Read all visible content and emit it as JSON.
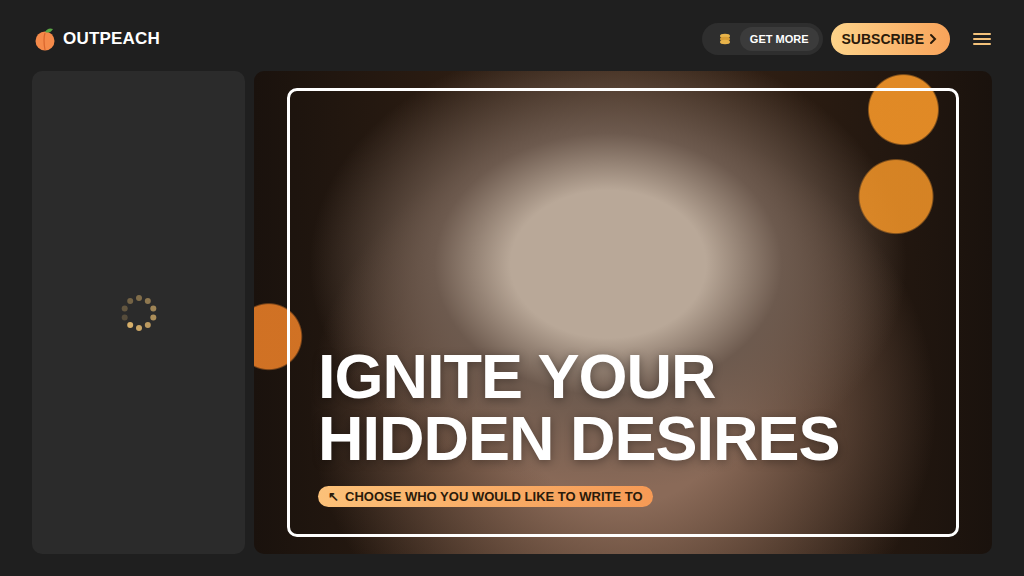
{
  "header": {
    "logo": "OUTPEACH",
    "get_more": "GET MORE",
    "subscribe": "SUBSCRIBE"
  },
  "sidebar": {
    "loading": true
  },
  "hero": {
    "title_lines": [
      "IGNITE YOUR",
      "HIDDEN DESIRES"
    ],
    "cta_icon": "↖",
    "cta": "CHOOSE WHO YOU WOULD LIKE TO WRITE TO"
  }
}
